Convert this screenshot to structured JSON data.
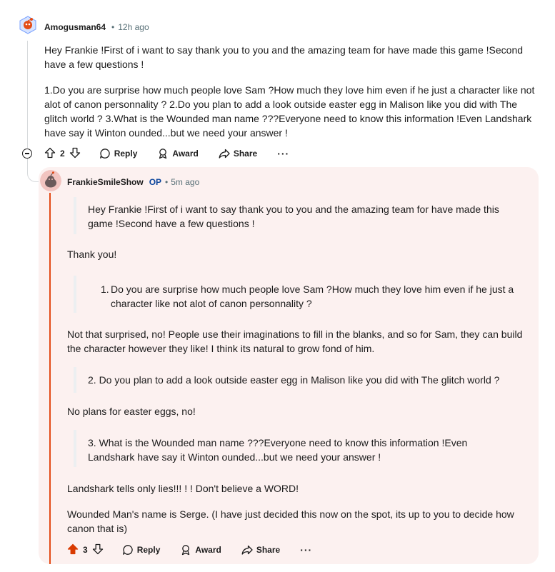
{
  "comment": {
    "author": "Amogusman64",
    "time": "12h ago",
    "paragraph1": "Hey Frankie !First of i want to say thank you to you and the amazing team for have made this game !Second have a few questions !",
    "paragraph2": "1.Do you are surprise how much people love Sam ?How much they love him even if he just a character like not alot of canon personnality ? 2.Do you plan to add a look outside easter egg in Malison like you did with The glitch world ? 3.What is the Wounded man name ???Everyone need to know this information !Even Landshark have say it Winton ounded...but we need your answer !",
    "votes": "2",
    "actions": {
      "reply": "Reply",
      "award": "Award",
      "share": "Share",
      "more": "···"
    }
  },
  "reply": {
    "author": "FrankieSmileShow",
    "op_badge": "OP",
    "time": "5m ago",
    "quote1": "Hey Frankie !First of i want to say thank you to you and the amazing team for have made this game !Second have a few questions !",
    "answer1": "Thank you!",
    "quote2_number": "1.",
    "quote2": "Do you are surprise how much people love Sam ?How much they love him even if he just a character like not alot of canon personnality ?",
    "answer2": "Not that surprised, no! People use their imaginations to fill in the blanks, and so for Sam, they can build the character however they like! I think its natural to grow fond of him.",
    "quote3": "2. Do you plan to add a look outside easter egg in Malison like you did with The glitch world ?",
    "answer3": "No plans for easter eggs, no!",
    "quote4": "3. What is the Wounded man name ???Everyone need to know this information !Even Landshark have say it Winton ounded...but we need your answer !",
    "answer4": "Landshark tells only lies!!! ! ! Don't believe a WORD!",
    "answer5": "Wounded Man's name is Serge. (I have just decided this now on the spot, its up to you to decide how canon that is)",
    "votes": "3",
    "actions": {
      "reply": "Reply",
      "award": "Award",
      "share": "Share",
      "more": "···"
    }
  },
  "colors": {
    "upvote_active": "#d93a00",
    "op_badge": "#0a449b",
    "thread_accent": "#e34b16",
    "reply_background": "#fcf1f0"
  }
}
